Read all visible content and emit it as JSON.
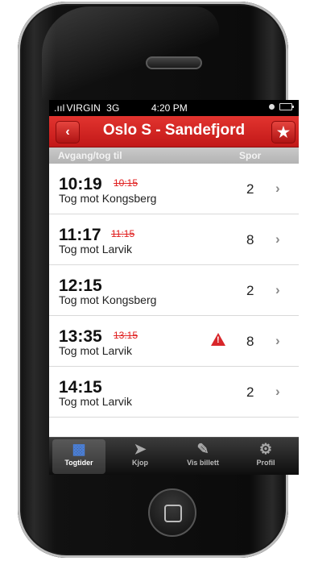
{
  "status_bar": {
    "carrier": "VIRGIN",
    "network": "3G",
    "time": "4:20 PM"
  },
  "nav": {
    "title": "Oslo S - Sandefjord",
    "back_icon": "chevron-left-icon",
    "favorite_icon": "star-icon"
  },
  "columns": {
    "departure": "Avgang/tog til",
    "track": "Spor"
  },
  "departures": [
    {
      "time": "10:19",
      "original_time": "10:15",
      "destination": "Tog mot Kongsberg",
      "track": "2",
      "warning": false
    },
    {
      "time": "11:17",
      "original_time": "11:15",
      "destination": "Tog mot Larvik",
      "track": "8",
      "warning": false
    },
    {
      "time": "12:15",
      "original_time": "",
      "destination": "Tog mot Kongsberg",
      "track": "2",
      "warning": false
    },
    {
      "time": "13:35",
      "original_time": "13:15",
      "destination": "Tog mot Larvik",
      "track": "8",
      "warning": true
    },
    {
      "time": "14:15",
      "original_time": "",
      "destination": "Tog mot Larvik",
      "track": "2",
      "warning": false
    }
  ],
  "tabs": [
    {
      "label": "Togtider",
      "icon": "train-icon",
      "active": true
    },
    {
      "label": "Kjop",
      "icon": "ticket-icon",
      "active": false
    },
    {
      "label": "Vis billett",
      "icon": "show-ticket-icon",
      "active": false
    },
    {
      "label": "Profil",
      "icon": "gear-icon",
      "active": false
    }
  ],
  "colors": {
    "accent_red": "#d32622",
    "delay_red": "#e02020"
  }
}
